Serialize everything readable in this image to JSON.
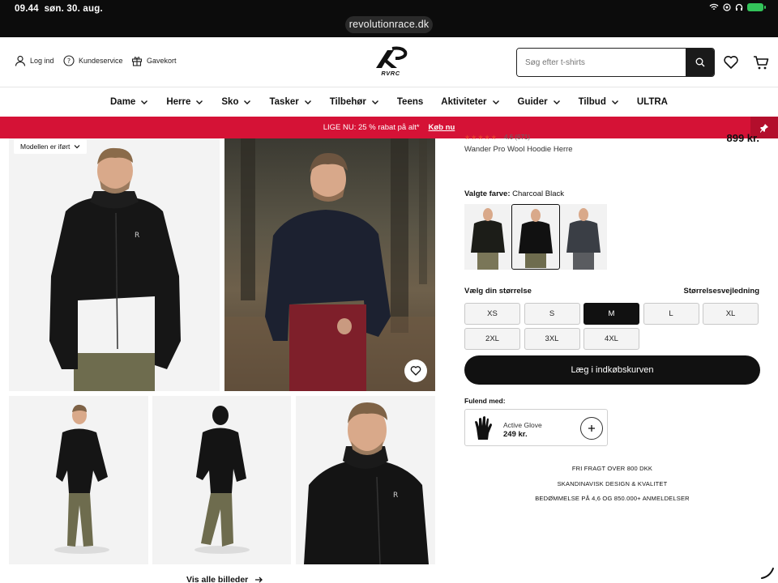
{
  "status": {
    "time": "09.44",
    "date": "søn. 30. aug."
  },
  "browser": {
    "url": "revolutionrace.dk"
  },
  "header": {
    "login": "Log ind",
    "customer_service": "Kundeservice",
    "gift_card": "Gavekort",
    "logo_text": "RVRC",
    "search_placeholder": "Søg efter t-shirts"
  },
  "nav": [
    {
      "label": "Dame",
      "dropdown": true
    },
    {
      "label": "Herre",
      "dropdown": true
    },
    {
      "label": "Sko",
      "dropdown": true
    },
    {
      "label": "Tasker",
      "dropdown": true
    },
    {
      "label": "Tilbehør",
      "dropdown": true
    },
    {
      "label": "Teens",
      "dropdown": false
    },
    {
      "label": "Aktiviteter",
      "dropdown": true
    },
    {
      "label": "Guider",
      "dropdown": true
    },
    {
      "label": "Tilbud",
      "dropdown": true
    },
    {
      "label": "ULTRA",
      "dropdown": false
    }
  ],
  "promo": {
    "text": "LIGE NU: 25 % rabat på alt*",
    "link": "Køb nu",
    "color": "#d51236"
  },
  "gallery": {
    "model_wearing": "Modellen er iført",
    "see_all": "Vis alle billeder"
  },
  "product": {
    "rating": "4.6 (671)",
    "price": "899 kr.",
    "name": "Wander Pro Wool Hoodie Herre",
    "color_label": "Valgte farve:",
    "color_value": "Charcoal Black",
    "size_label": "Vælg din størrelse",
    "size_guide": "Størrelsesvejledning",
    "sizes": [
      "XS",
      "S",
      "M",
      "L",
      "XL",
      "2XL",
      "3XL",
      "4XL"
    ],
    "selected_size": "M",
    "add_to_cart": "Læg i indkøbskurven"
  },
  "complete_with": {
    "label": "Fulend med:",
    "item_name": "Active Glove",
    "item_price": "249 kr."
  },
  "usps": [
    "FRI FRAGT OVER 800 DKK",
    "SKANDINAVISK DESIGN & KVALITET",
    "BEDØMMELSE PÅ 4,6 OG 850.000+ ANMELDELSER"
  ]
}
